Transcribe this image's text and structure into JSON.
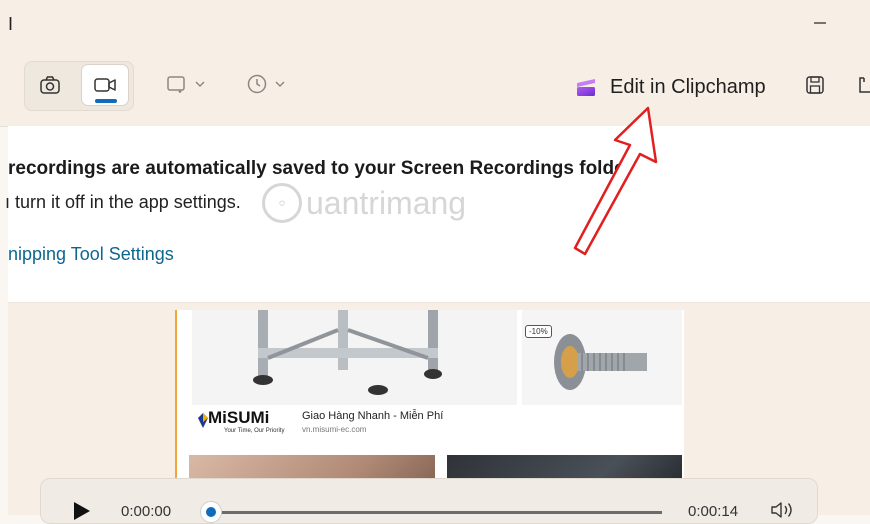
{
  "window": {
    "title_fragment": "I"
  },
  "toolbar": {
    "modes": [
      {
        "name": "screenshot",
        "icon": "camera-icon",
        "selected": false
      },
      {
        "name": "record",
        "icon": "video-camera-icon",
        "selected": true
      }
    ],
    "shape_dropdown_icon": "rectangle-capture-icon",
    "timer_dropdown_icon": "clock-icon",
    "clipchamp_label": "Edit in Clipchamp",
    "accent_color": "#0f6cbd"
  },
  "notice": {
    "bold": "recordings are automatically saved to your Screen Recordings folder",
    "sub": "ı turn it off in the app settings.",
    "link": "nipping Tool Settings",
    "link_color": "#0d6690"
  },
  "watermark": {
    "text": "uantrimang"
  },
  "preview": {
    "discount_badge": "-10%",
    "brand": "MiSUMi",
    "brand_tagline": "Your Time, Our Priority",
    "ad_headline": "Giao Hàng Nhanh - Miễn Phí",
    "ad_url": "vn.misumi-ec.com"
  },
  "player": {
    "current_time": "0:00:00",
    "end_time": "0:00:14",
    "progress": 0.0
  }
}
